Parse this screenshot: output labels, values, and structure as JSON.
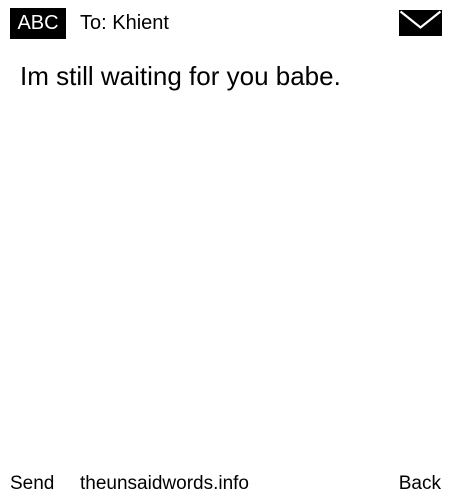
{
  "header": {
    "mode_badge": "ABC",
    "recipient": "To: Khient",
    "icon": "mail-envelope-icon"
  },
  "message": {
    "text": "Im still waiting for you babe."
  },
  "footer": {
    "send_label": "Send",
    "site_label": "theunsaidwords.info",
    "back_label": "Back"
  },
  "colors": {
    "background": "#ffffff",
    "badge_background": "#000000",
    "badge_text": "#ffffff",
    "text": "#000000"
  }
}
